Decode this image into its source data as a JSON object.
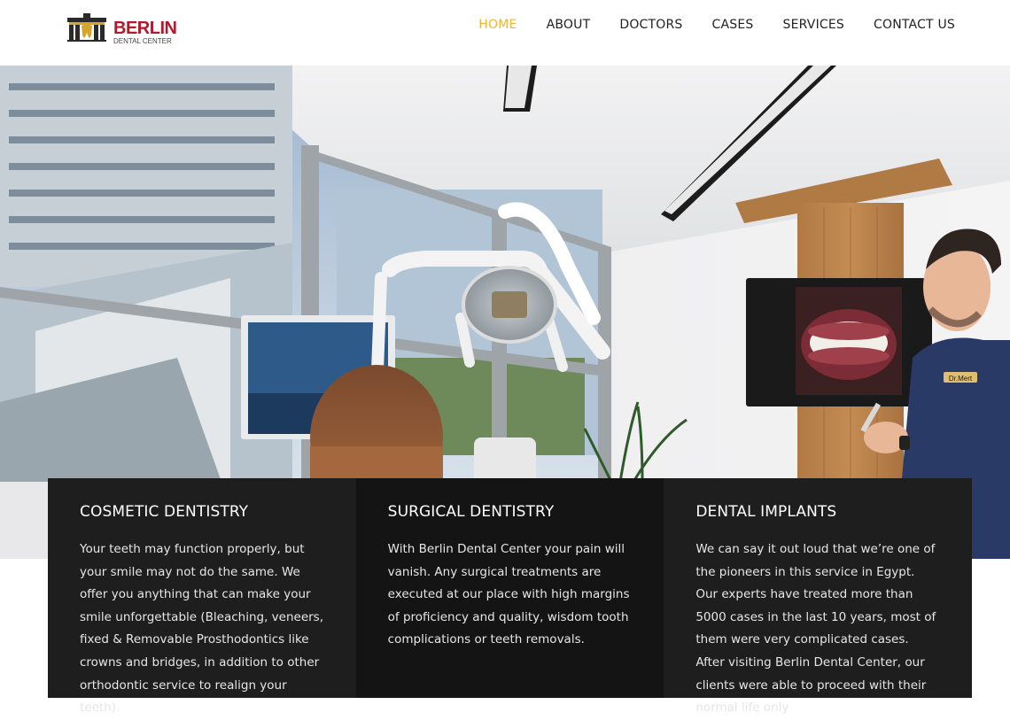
{
  "brand": {
    "name": "BERLIN",
    "subtitle": "DENTAL CENTER",
    "colors": {
      "brand_red": "#b3182c",
      "nav_active": "#f0b63a",
      "logo_dark": "#2a2a2a",
      "logo_gold": "#d9a42b"
    }
  },
  "nav": {
    "items": [
      {
        "label": "HOME",
        "active": true
      },
      {
        "label": "ABOUT",
        "active": false
      },
      {
        "label": "DOCTORS",
        "active": false
      },
      {
        "label": "CASES",
        "active": false
      },
      {
        "label": "SERVICES",
        "active": false
      },
      {
        "label": "CONTACT US",
        "active": false
      }
    ]
  },
  "hero": {
    "image_icon": "dental-clinic-photo",
    "monitor_badge": "Dr.Mert"
  },
  "services": [
    {
      "title": "COSMETIC DENTISTRY",
      "text": "Your teeth may function properly, but your smile may not do the same. We offer you anything that can make your smile unforgettable (Bleaching, veneers, fixed & Removable Prosthodontics like crowns and bridges, in addition to other orthodontic service to realign your teeth)."
    },
    {
      "title": "SURGICAL DENTISTRY",
      "text": "With Berlin Dental Center your pain will vanish. Any surgical treatments are executed at our place with high margins of proficiency and quality, wisdom tooth complications or teeth removals."
    },
    {
      "title": "DENTAL IMPLANTS",
      "text": "We can say it out loud that we’re one of the pioneers in this service in Egypt. Our experts have treated more than 5000 cases in the last 10 years, most of them were very complicated cases. After visiting Berlin Dental Center, our clients were able to proceed with their normal life only"
    }
  ]
}
